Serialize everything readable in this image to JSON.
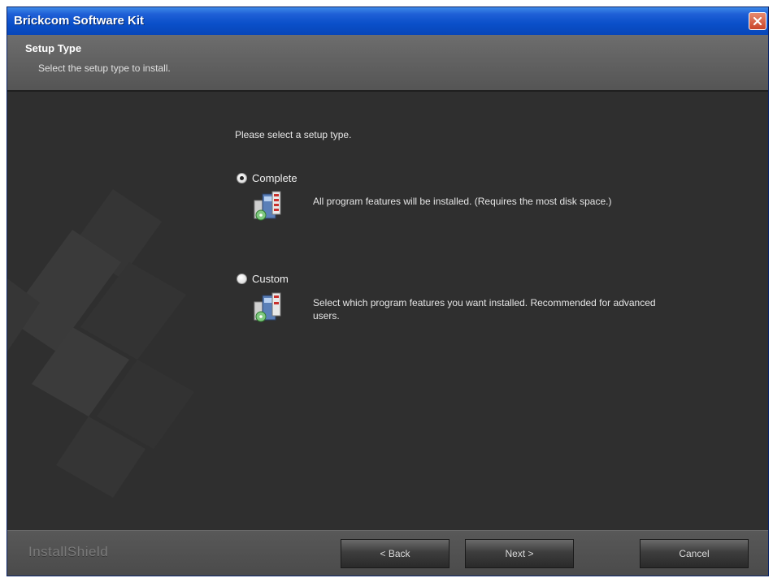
{
  "window": {
    "title": "Brickcom Software Kit"
  },
  "header": {
    "title": "Setup Type",
    "subtitle": "Select the setup type to install."
  },
  "main": {
    "prompt": "Please select a setup type.",
    "options": [
      {
        "label": "Complete",
        "selected": true,
        "description": "All program features will be installed. (Requires the most disk space.)"
      },
      {
        "label": "Custom",
        "selected": false,
        "description_line1": "Select which program features you want installed. Recommended for advanced",
        "description_line2": "users."
      }
    ]
  },
  "footer": {
    "brand": "InstallShield",
    "buttons": {
      "back": "< Back",
      "next": "Next >",
      "cancel": "Cancel"
    }
  },
  "colors": {
    "titlebar": "#0a4fc9",
    "body": "#2f2f2f",
    "header": "#5f5f5f",
    "footer": "#4f4f4f",
    "close": "#c9452a"
  },
  "icons": {
    "close": "close-icon",
    "setup": "setup-package-icon"
  }
}
